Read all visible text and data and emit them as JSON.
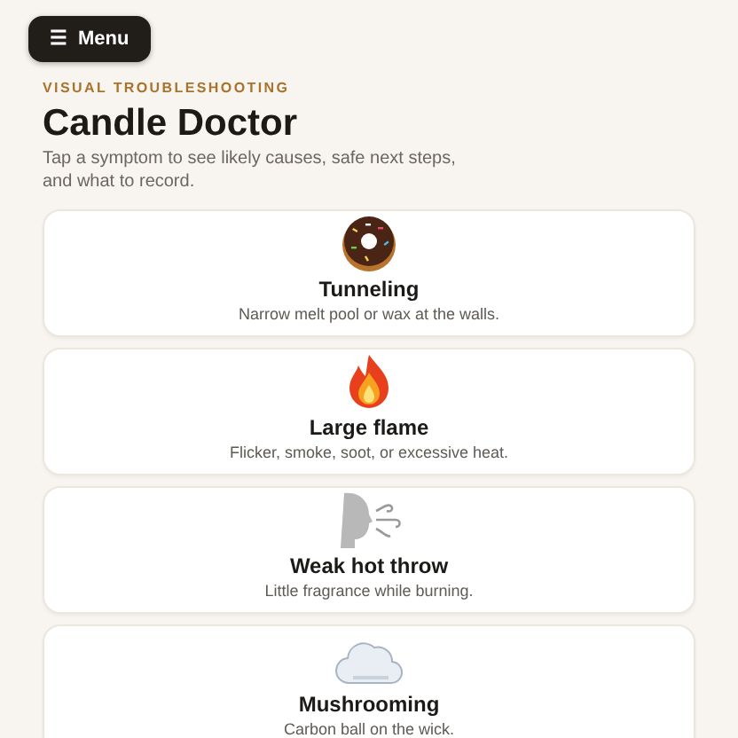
{
  "menu_button": {
    "icon": "☰",
    "label": "Menu"
  },
  "eyebrow": "VISUAL TROUBLESHOOTING",
  "title": "Candle Doctor",
  "subtitle": "Tap a symptom to see likely causes, safe next steps, and what to record.",
  "symptoms": [
    {
      "kind": "donut",
      "title": "Tunneling",
      "description": "Narrow melt pool or wax at the walls."
    },
    {
      "kind": "flame",
      "title": "Large flame",
      "description": "Flicker, smoke, soot, or excessive heat."
    },
    {
      "kind": "wind",
      "title": "Weak hot throw",
      "description": "Little fragrance while burning."
    },
    {
      "kind": "cloud",
      "title": "Mushrooming",
      "description": "Carbon ball on the wick."
    }
  ]
}
